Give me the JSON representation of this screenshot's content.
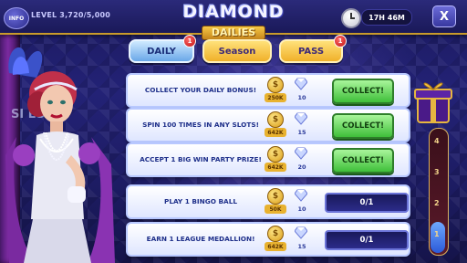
{
  "header": {
    "info_label": "INFO",
    "progress_text": "LEVEL 3,720/5,000",
    "logo_top": "DIAMOND",
    "logo_bottom": "DAILIES",
    "timer": "17H 46M",
    "close_label": "X"
  },
  "tabs": [
    {
      "label": "DAILY",
      "badge": "1"
    },
    {
      "label": "Season",
      "badge": ""
    },
    {
      "label": "PASS",
      "badge": "1"
    }
  ],
  "background_text": "SI      ES AT",
  "quests": [
    {
      "description": "COLLECT YOUR DAILY BONUS!",
      "coins": "250K",
      "gems": "10",
      "action": "COLLECT!",
      "progress": ""
    },
    {
      "description": "SPIN 100 TIMES IN ANY SLOTS!",
      "coins": "642K",
      "gems": "15",
      "action": "COLLECT!",
      "progress": ""
    },
    {
      "description": "ACCEPT 1 BIG WIN PARTY PRIZE!",
      "coins": "642K",
      "gems": "20",
      "action": "COLLECT!",
      "progress": ""
    },
    {
      "description": "PLAY 1 BINGO BALL",
      "coins": "50K",
      "gems": "10",
      "action": "",
      "progress": "0/1"
    },
    {
      "description": "EARN 1 LEAGUE MEDALLION!",
      "coins": "642K",
      "gems": "15",
      "action": "",
      "progress": "0/1"
    }
  ],
  "milestones": [
    "4",
    "3",
    "2",
    "1"
  ],
  "milestone_progress": 1,
  "icons": {
    "coin": "coin-icon",
    "gem": "gem-icon",
    "gift": "gift-icon",
    "clock": "clock-icon"
  },
  "colors": {
    "background": "#1d1c63",
    "gold": "#e8b230",
    "collect_green": "#3fbf3a",
    "tab_active": "#6aa7e8"
  }
}
